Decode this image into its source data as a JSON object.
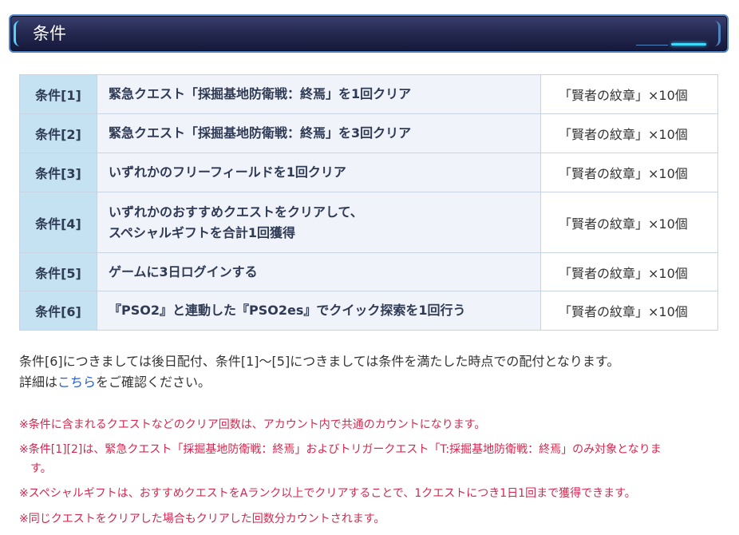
{
  "header": {
    "title": "条件"
  },
  "table": {
    "rows": [
      {
        "label": "条件[1]",
        "desc": "緊急クエスト「採掘基地防衛戦：終焉」を1回クリア",
        "desc2": "",
        "reward": "「賢者の紋章」×10個"
      },
      {
        "label": "条件[2]",
        "desc": "緊急クエスト「採掘基地防衛戦：終焉」を3回クリア",
        "desc2": "",
        "reward": "「賢者の紋章」×10個"
      },
      {
        "label": "条件[3]",
        "desc": "いずれかのフリーフィールドを1回クリア",
        "desc2": "",
        "reward": "「賢者の紋章」×10個"
      },
      {
        "label": "条件[4]",
        "desc": "いずれかのおすすめクエストをクリアして、",
        "desc2": "スペシャルギフトを合計1回獲得",
        "reward": "「賢者の紋章」×10個"
      },
      {
        "label": "条件[5]",
        "desc": "ゲームに3日ログインする",
        "desc2": "",
        "reward": "「賢者の紋章」×10個"
      },
      {
        "label": "条件[6]",
        "desc": "『PSO2』と連動した『PSO2es』でクイック探索を1回行う",
        "desc2": "",
        "reward": "「賢者の紋章」×10個"
      }
    ]
  },
  "note": {
    "line1": "条件[6]につきましては後日配付、条件[1]～[5]につきましては条件を満たした時点での配付となります。",
    "line2_prefix": "詳細は",
    "line2_link": "こちら",
    "line2_suffix": "をご確認ください。"
  },
  "warnings": {
    "w1": "※条件に含まれるクエストなどのクリア回数は、アカウント内で共通のカウントになります。",
    "w2a": "※条件[1][2]は、緊急クエスト「採掘基地防衛戦：終焉」およびトリガークエスト「T:採掘基地防衛戦：終焉」のみ対象となりま",
    "w2b": "す。",
    "w3": "※スペシャルギフトは、おすすめクエストをAランク以上でクリアすることで、1クエストにつき1日1回まで獲得できます。",
    "w4": "※同じクエストをクリアした場合もクリアした回数分カウントされます。"
  },
  "colors": {
    "header_bg": "#262a52",
    "header_border": "#4f83c2",
    "header_accent": "#3fd8ff",
    "label_cell": "#c4e2f1",
    "desc_cell": "#f0f3f9",
    "link": "#2a5fd1",
    "warning_text": "#d4284f"
  }
}
